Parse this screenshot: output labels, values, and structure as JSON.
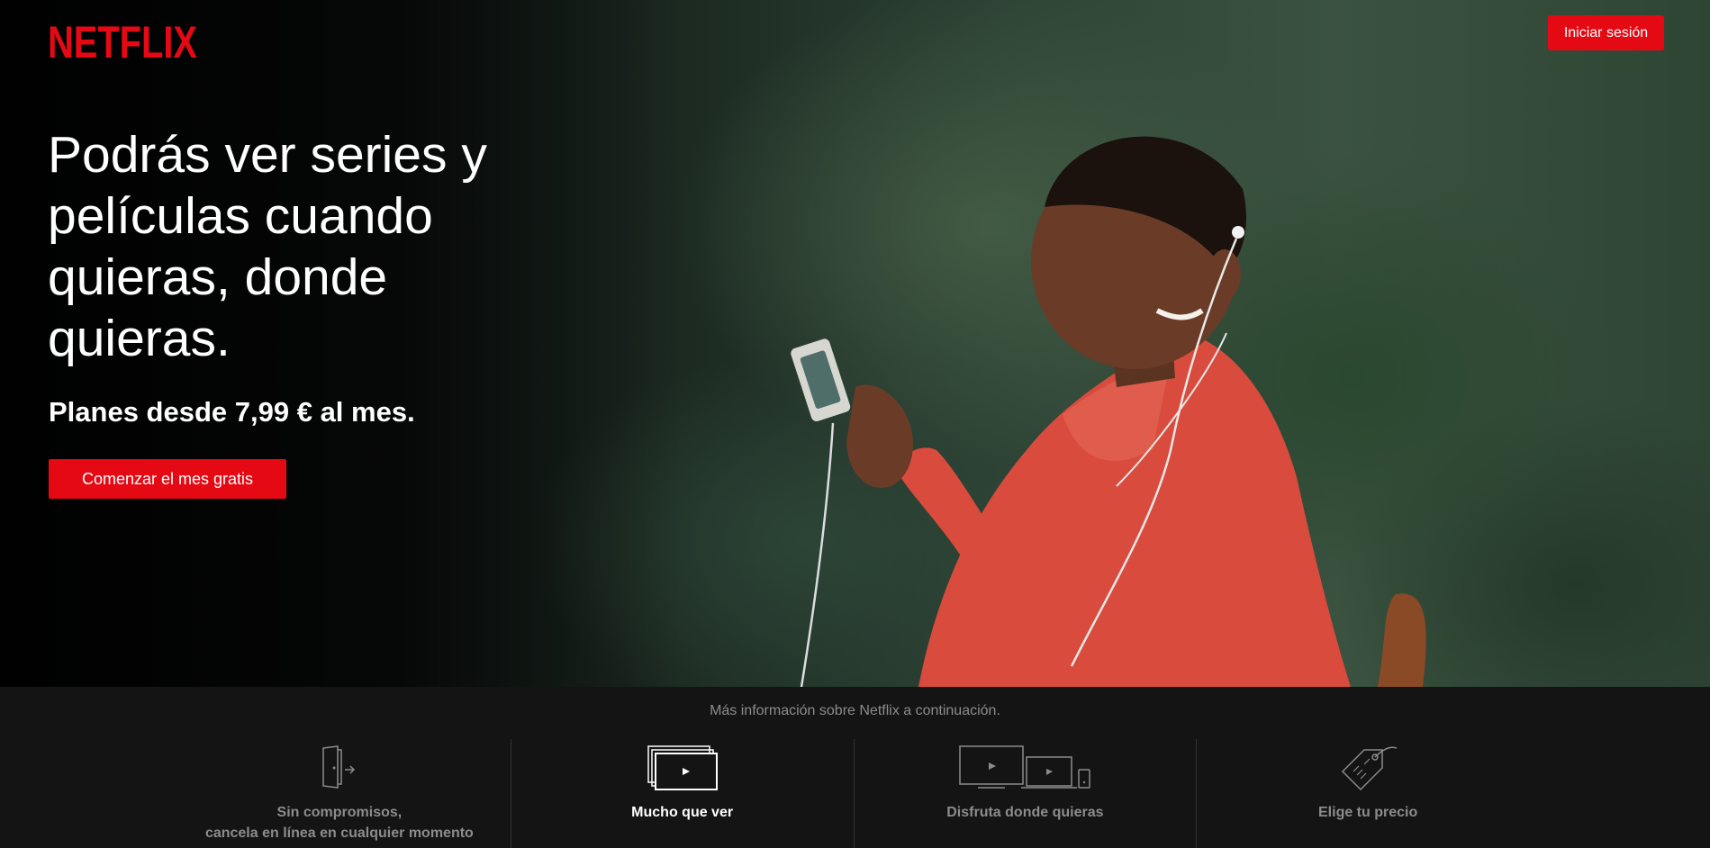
{
  "brand": {
    "logo_text": "NETFLIX",
    "accent_color": "#e50914"
  },
  "header": {
    "login_label": "Iniciar sesión"
  },
  "hero": {
    "headline": "Podrás ver series y películas cuando quieras, donde quieras.",
    "subhead": "Planes desde 7,99 € al mes.",
    "cta_label": "Comenzar el mes gratis"
  },
  "info_bar": {
    "more_info": "Más información sobre Netflix a continuación.",
    "tabs": [
      {
        "label_line1": "Sin compromisos,",
        "label_line2": "cancela en línea en cualquier momento",
        "icon": "door-icon",
        "active": false
      },
      {
        "label_line1": "Mucho que ver",
        "label_line2": "",
        "icon": "screens-play-icon",
        "active": true
      },
      {
        "label_line1": "Disfruta donde quieras",
        "label_line2": "",
        "icon": "devices-icon",
        "active": false
      },
      {
        "label_line1": "Elige tu precio",
        "label_line2": "",
        "icon": "price-tag-icon",
        "active": false
      }
    ]
  }
}
